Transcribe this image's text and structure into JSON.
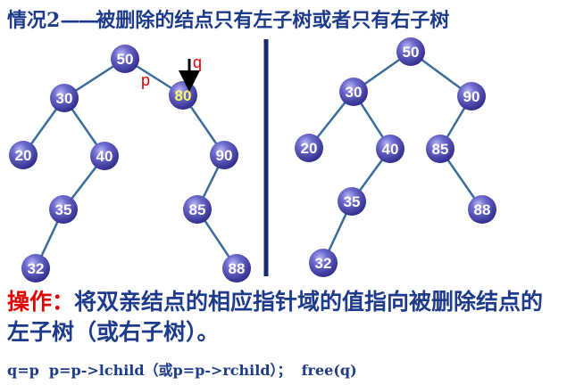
{
  "header": {
    "case_label": "情况2",
    "dashes": "——",
    "description": "被删除的结点只有左子树或者只有右子树"
  },
  "pointer_labels": {
    "p": "p",
    "q": "q"
  },
  "colors": {
    "text_primary": "#1e3a8a",
    "accent_red": "#e00000",
    "node_fill": "#5b58c4",
    "highlight_text": "#ffff66",
    "divider": "#1a2a6e",
    "edge": "#3b6b9a"
  },
  "tree_before": {
    "nodes": [
      {
        "id": "n50",
        "value": "50"
      },
      {
        "id": "n30",
        "value": "30"
      },
      {
        "id": "n80",
        "value": "80",
        "highlight": true
      },
      {
        "id": "n20",
        "value": "20"
      },
      {
        "id": "n40",
        "value": "40"
      },
      {
        "id": "n90",
        "value": "90"
      },
      {
        "id": "n35",
        "value": "35"
      },
      {
        "id": "n85",
        "value": "85"
      },
      {
        "id": "n32",
        "value": "32"
      },
      {
        "id": "n88",
        "value": "88"
      }
    ],
    "edges": [
      [
        "n50",
        "n30"
      ],
      [
        "n50",
        "n80"
      ],
      [
        "n30",
        "n20"
      ],
      [
        "n30",
        "n40"
      ],
      [
        "n80",
        "n90"
      ],
      [
        "n40",
        "n35"
      ],
      [
        "n90",
        "n85"
      ],
      [
        "n35",
        "n32"
      ],
      [
        "n85",
        "n88"
      ]
    ]
  },
  "tree_after": {
    "nodes": [
      {
        "id": "m50",
        "value": "50"
      },
      {
        "id": "m30",
        "value": "30"
      },
      {
        "id": "m90",
        "value": "90"
      },
      {
        "id": "m20",
        "value": "20"
      },
      {
        "id": "m40",
        "value": "40"
      },
      {
        "id": "m85",
        "value": "85"
      },
      {
        "id": "m35",
        "value": "35"
      },
      {
        "id": "m88",
        "value": "88"
      },
      {
        "id": "m32",
        "value": "32"
      }
    ],
    "edges": [
      [
        "m50",
        "m30"
      ],
      [
        "m50",
        "m90"
      ],
      [
        "m30",
        "m20"
      ],
      [
        "m30",
        "m40"
      ],
      [
        "m90",
        "m85"
      ],
      [
        "m40",
        "m35"
      ],
      [
        "m85",
        "m88"
      ],
      [
        "m35",
        "m32"
      ]
    ]
  },
  "operation": {
    "label": "操作：",
    "text": "将双亲结点的相应指针域的值指向被删除结点的左子树（或右子树）。"
  },
  "code": "q=p  p=p->lchild（或p=p->rchild）；  free(q)"
}
